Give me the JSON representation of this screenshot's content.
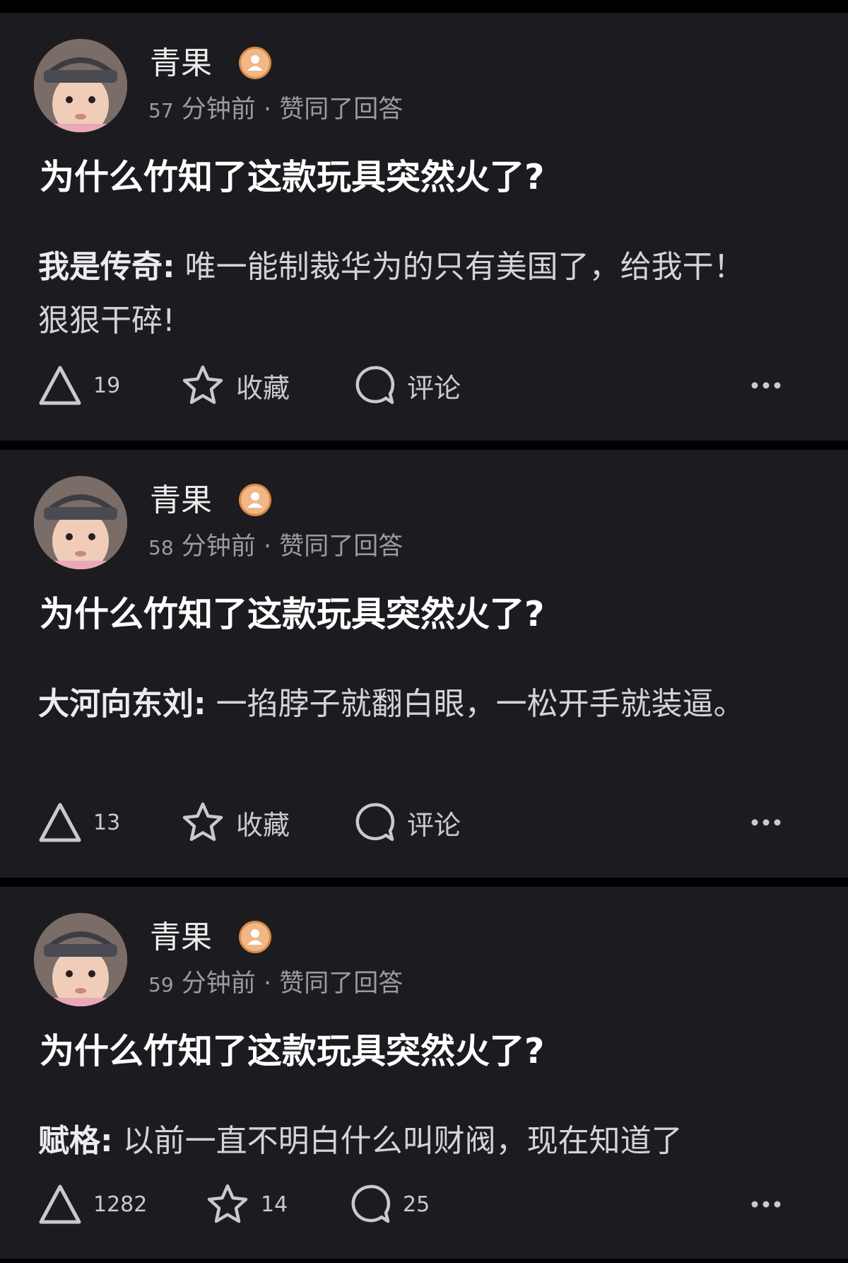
{
  "feed": [
    {
      "username": "青果",
      "time_num": "57",
      "time_unit": "分钟前",
      "separator": "·",
      "action": "赞同了回答",
      "question": "为什么竹知了这款玩具突然火了?",
      "answer_author": "我是传奇",
      "answer_colon": ":",
      "answer_text": "唯一能制裁华为的只有美国了，给我干！狠狠干碎!",
      "upvote_count": "19",
      "favorite_label": "收藏",
      "comment_label": "评论"
    },
    {
      "username": "青果",
      "time_num": "58",
      "time_unit": "分钟前",
      "separator": "·",
      "action": "赞同了回答",
      "question": "为什么竹知了这款玩具突然火了?",
      "answer_author": "大河向东刘",
      "answer_colon": ":",
      "answer_text": "一掐脖子就翻白眼，一松开手就装逼。",
      "upvote_count": "13",
      "favorite_label": "收藏",
      "comment_label": "评论"
    },
    {
      "username": "青果",
      "time_num": "59",
      "time_unit": "分钟前",
      "separator": "·",
      "action": "赞同了回答",
      "question": "为什么竹知了这款玩具突然火了?",
      "answer_author": "赋格",
      "answer_colon": ":",
      "answer_text": "以前一直不明白什么叫财阀，现在知道了",
      "upvote_count": "1282",
      "favorite_label": "14",
      "comment_label": "25"
    }
  ],
  "icons": {
    "avatar": "avatar-photo",
    "badge": "user-badge-icon",
    "upvote": "upvote-triangle-icon",
    "favorite": "star-icon",
    "comment": "comment-bubble-icon",
    "more": "more-dots-icon"
  },
  "colors": {
    "page_bg": "#000000",
    "card_bg": "#1b1b20",
    "text_primary": "#ffffff",
    "text_secondary": "#9b9ba3",
    "badge": "#f0b886"
  }
}
